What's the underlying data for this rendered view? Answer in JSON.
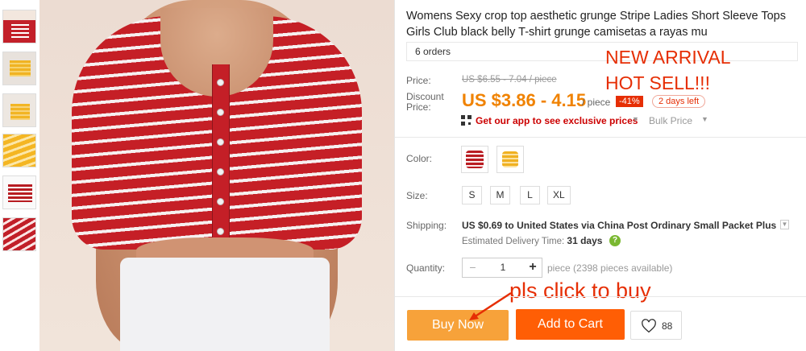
{
  "product": {
    "title": "Womens Sexy crop top aesthetic grunge Stripe Ladies Short Sleeve Tops Girls Club black belly T-shirt grunge camisetas a rayas mu",
    "orders": "6 orders"
  },
  "promo_text": {
    "line1": "NEW ARRIVAL",
    "line2": "HOT SELL!!!",
    "click_note": "pls click to buy"
  },
  "price": {
    "label": "Price:",
    "original": "US $6.55 - 7.04 / piece",
    "discount_label_1": "Discount",
    "discount_label_2": "Price:",
    "discount": "US $3.86 - 4.15",
    "per": "/ piece",
    "percent_off": "-41%",
    "time_left": "2 days left"
  },
  "app_promo": {
    "link": "Get our app to see exclusive prices",
    "bulk": "Bulk Price",
    "icon": "qr-code-icon"
  },
  "options": {
    "color_label": "Color:",
    "colors": [
      "red-stripe",
      "yellow-stripe"
    ],
    "size_label": "Size:",
    "sizes": [
      "S",
      "M",
      "L",
      "XL"
    ]
  },
  "shipping": {
    "label": "Shipping:",
    "cost": "US $0.69",
    "to": "to",
    "destination": "United States",
    "via": "via",
    "method": "China Post Ordinary Small Packet Plus",
    "est_label": "Estimated Delivery Time:",
    "est_days": "31 days"
  },
  "quantity": {
    "label": "Quantity:",
    "minus": "−",
    "value": "1",
    "plus": "+",
    "available": "piece (2398 pieces available)"
  },
  "actions": {
    "buy_now": "Buy Now",
    "add_to_cart": "Add to Cart",
    "wishlist_count": "88"
  },
  "colors": {
    "accent_red": "#e62e04",
    "price_orange": "#f08200",
    "buy_now_bg": "#f7a23a",
    "cart_bg": "#ff5e05"
  }
}
